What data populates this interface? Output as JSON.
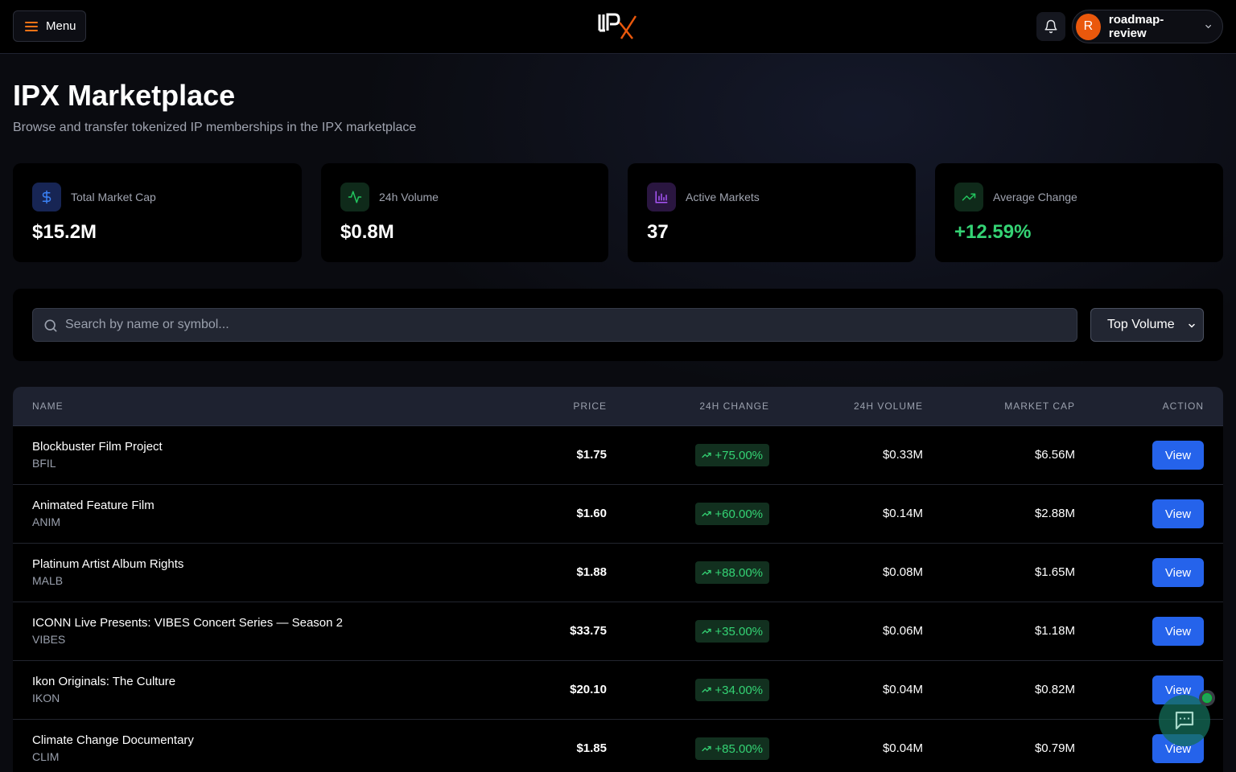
{
  "header": {
    "menu_label": "Menu",
    "logo_icon": "ipx-logo",
    "notifications_icon": "bell-icon",
    "user": {
      "initial": "R",
      "name": "roadmap-review",
      "avatar_color": "#ea580c"
    }
  },
  "page": {
    "title": "IPX Marketplace",
    "subtitle": "Browse and transfer tokenized IP memberships in the IPX marketplace"
  },
  "stats": [
    {
      "label": "Total Market Cap",
      "value": "$15.2M",
      "icon": "dollar-icon",
      "color": "#3b82f6"
    },
    {
      "label": "24h Volume",
      "value": "$0.8M",
      "icon": "activity-icon",
      "color": "#22c55e"
    },
    {
      "label": "Active Markets",
      "value": "37",
      "icon": "bar-chart-icon",
      "color": "#a855f7"
    },
    {
      "label": "Average Change",
      "value": "+12.59%",
      "icon": "trending-up-icon",
      "color": "#22c55e"
    }
  ],
  "search": {
    "placeholder": "Search by name or symbol...",
    "value": ""
  },
  "sort": {
    "selected": "Top Volume"
  },
  "table": {
    "columns": {
      "name": "NAME",
      "price": "PRICE",
      "change": "24H CHANGE",
      "volume": "24H VOLUME",
      "market_cap": "MARKET CAP",
      "action": "ACTION"
    },
    "rows": [
      {
        "name": "Blockbuster Film Project",
        "symbol": "BFIL",
        "price": "$1.75",
        "change": "+75.00%",
        "volume": "$0.33M",
        "market_cap": "$6.56M",
        "action": "View"
      },
      {
        "name": "Animated Feature Film",
        "symbol": "ANIM",
        "price": "$1.60",
        "change": "+60.00%",
        "volume": "$0.14M",
        "market_cap": "$2.88M",
        "action": "View"
      },
      {
        "name": "Platinum Artist Album Rights",
        "symbol": "MALB",
        "price": "$1.88",
        "change": "+88.00%",
        "volume": "$0.08M",
        "market_cap": "$1.65M",
        "action": "View"
      },
      {
        "name": "ICONN Live Presents: VIBES Concert Series — Season 2",
        "symbol": "VIBES",
        "price": "$33.75",
        "change": "+35.00%",
        "volume": "$0.06M",
        "market_cap": "$1.18M",
        "action": "View"
      },
      {
        "name": "Ikon Originals: The Culture",
        "symbol": "IKON",
        "price": "$20.10",
        "change": "+34.00%",
        "volume": "$0.04M",
        "market_cap": "$0.82M",
        "action": "View"
      },
      {
        "name": "Climate Change Documentary",
        "symbol": "CLIM",
        "price": "$1.85",
        "change": "+85.00%",
        "volume": "$0.04M",
        "market_cap": "$0.79M",
        "action": "View"
      }
    ]
  },
  "chat": {
    "icon": "chat-icon",
    "status_color": "#22a05a"
  },
  "colors": {
    "accent": "#f97316",
    "primary_button": "#2563eb",
    "positive": "#34d374"
  }
}
